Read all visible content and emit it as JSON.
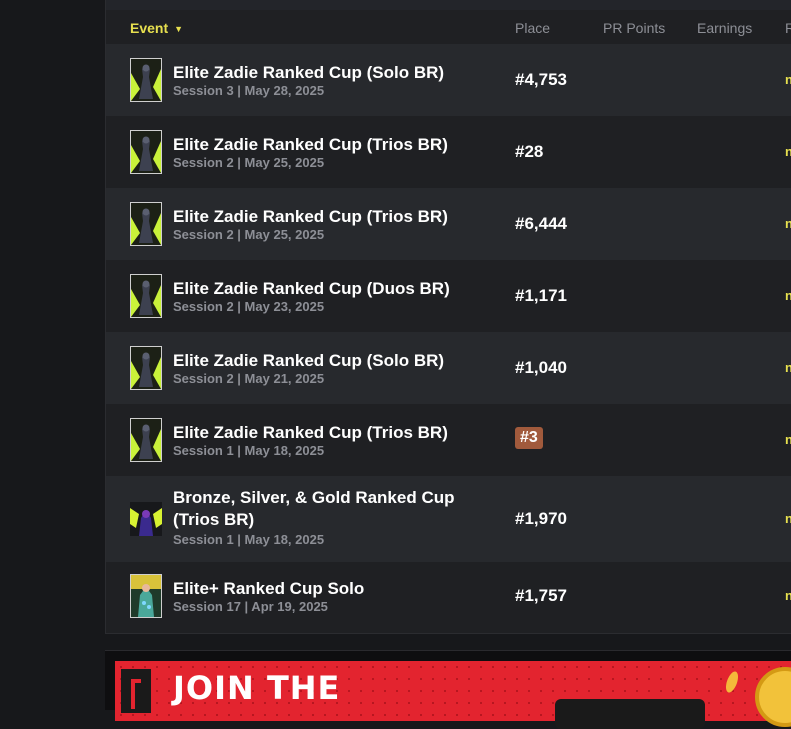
{
  "table": {
    "headers": {
      "event": "Event",
      "place": "Place",
      "pr_points": "PR Points",
      "earnings": "Earnings",
      "extra": "R"
    },
    "rows": [
      {
        "title": "Elite Zadie Ranked Cup (Solo BR)",
        "subtitle": "Session 3 | May 28, 2025",
        "place": "#4,753",
        "trail": "n",
        "thumb": "zadie"
      },
      {
        "title": "Elite Zadie Ranked Cup (Trios BR)",
        "subtitle": "Session 2 | May 25, 2025",
        "place": "#28",
        "trail": "n",
        "thumb": "zadie"
      },
      {
        "title": "Elite Zadie Ranked Cup (Trios BR)",
        "subtitle": "Session 2 | May 25, 2025",
        "place": "#6,444",
        "trail": "n",
        "thumb": "zadie"
      },
      {
        "title": "Elite Zadie Ranked Cup (Duos BR)",
        "subtitle": "Session 2 | May 23, 2025",
        "place": "#1,171",
        "trail": "n",
        "thumb": "zadie"
      },
      {
        "title": "Elite Zadie Ranked Cup (Solo BR)",
        "subtitle": "Session 2 | May 21, 2025",
        "place": "#1,040",
        "trail": "n",
        "thumb": "zadie"
      },
      {
        "title": "Elite Zadie Ranked Cup (Trios BR)",
        "subtitle": "Session 1 | May 18, 2025",
        "place": "#3",
        "trail": "n",
        "thumb": "zadie",
        "podium": true
      },
      {
        "title_line1": "Bronze, Silver, & Gold Ranked Cup",
        "title_line2": "(Trios BR)",
        "subtitle": "Session 1 | May 18, 2025",
        "place": "#1,970",
        "trail": "n",
        "thumb": "bsg"
      },
      {
        "title": "Elite+ Ranked Cup Solo",
        "subtitle": "Session 17 | Apr 19, 2025",
        "place": "#1,757",
        "trail": "n",
        "thumb": "eliteplus"
      }
    ]
  },
  "banner": {
    "text": "JOIN THE"
  },
  "colors": {
    "accent": "#e7e04f",
    "podium_bg": "#a15a3c",
    "banner_red": "#e3242f"
  }
}
